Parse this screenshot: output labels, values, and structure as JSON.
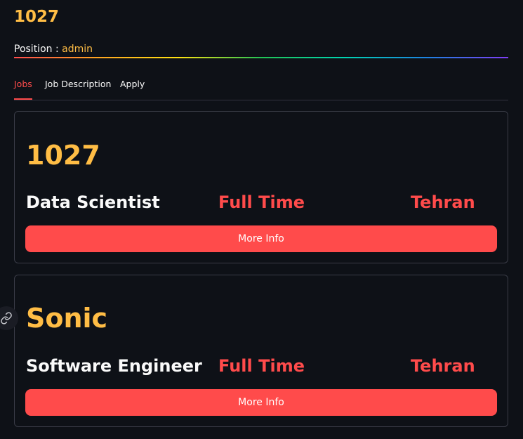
{
  "header": {
    "title": "1027",
    "position_label": "Position : ",
    "position_value": "admin"
  },
  "tabs": [
    {
      "label": "Jobs",
      "active": true
    },
    {
      "label": "Job Description",
      "active": false
    },
    {
      "label": "Apply",
      "active": false
    }
  ],
  "jobs": [
    {
      "name": "1027",
      "title": "Data Scientist",
      "type": "Full Time",
      "location": "Tehran",
      "button_label": "More Info"
    },
    {
      "name": "Sonic",
      "title": "Software Engineer",
      "type": "Full Time",
      "location": "Tehran",
      "button_label": "More Info"
    }
  ],
  "icons": {
    "anchor": "link-icon"
  },
  "colors": {
    "background": "#0e1117",
    "accent": "#ff4b4b",
    "highlight": "#ffbd45",
    "text": "#fafafa"
  }
}
